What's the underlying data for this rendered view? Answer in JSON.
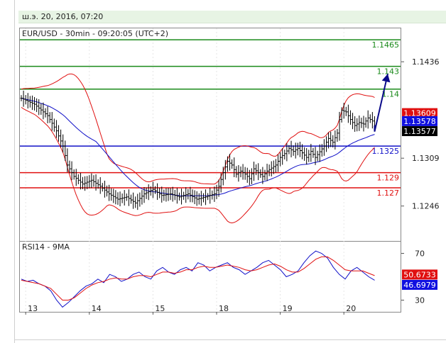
{
  "header": {
    "timestamp": "ш.э. 20, 2016, 07:20"
  },
  "chart_data": [
    {
      "type": "line",
      "panel": "price",
      "title": "EUR/USD - 30min - 09:20:05 (UTC+2)",
      "x_tick_labels": [
        "13",
        "14",
        "15",
        "18",
        "19",
        "20"
      ],
      "y_tick_labels": [
        "1.1436",
        "1.1309",
        "1.1246"
      ],
      "ylim": [
        1.12,
        1.148
      ],
      "levels": [
        {
          "label": "1.1465",
          "value": 1.1465,
          "color": "#1a8a1a"
        },
        {
          "label": "1.143",
          "value": 1.143,
          "color": "#1a8a1a"
        },
        {
          "label": "1.14",
          "value": 1.14,
          "color": "#1a8a1a"
        },
        {
          "label": "1.1325",
          "value": 1.1325,
          "color": "#1010c8"
        },
        {
          "label": "1.129",
          "value": 1.129,
          "color": "#e01010"
        },
        {
          "label": "1.127",
          "value": 1.127,
          "color": "#e01010"
        }
      ],
      "badges": [
        {
          "label": "1.13609",
          "value": 1.13609,
          "color": "#e01010"
        },
        {
          "label": "1.13578",
          "value": 1.13578,
          "color": "#1010e0"
        },
        {
          "label": "1.13577",
          "value": 1.13577,
          "color": "#000000"
        }
      ],
      "price_path": [
        [
          0,
          1.1388
        ],
        [
          6,
          1.138
        ],
        [
          12,
          1.1365
        ],
        [
          16,
          1.1345
        ],
        [
          19,
          1.1325
        ],
        [
          21,
          1.13
        ],
        [
          24,
          1.1285
        ],
        [
          28,
          1.1275
        ],
        [
          32,
          1.128
        ],
        [
          36,
          1.1272
        ],
        [
          40,
          1.1262
        ],
        [
          44,
          1.1255
        ],
        [
          48,
          1.1258
        ],
        [
          52,
          1.125
        ],
        [
          56,
          1.1262
        ],
        [
          60,
          1.1268
        ],
        [
          64,
          1.126
        ],
        [
          68,
          1.1262
        ],
        [
          72,
          1.1258
        ],
        [
          76,
          1.1262
        ],
        [
          80,
          1.1255
        ],
        [
          84,
          1.1258
        ],
        [
          88,
          1.1262
        ],
        [
          90,
          1.1272
        ],
        [
          92,
          1.129
        ],
        [
          94,
          1.1305
        ],
        [
          96,
          1.13
        ],
        [
          98,
          1.1288
        ],
        [
          100,
          1.1292
        ],
        [
          102,
          1.1288
        ],
        [
          104,
          1.1282
        ],
        [
          106,
          1.1295
        ],
        [
          108,
          1.129
        ],
        [
          110,
          1.1285
        ],
        [
          112,
          1.1292
        ],
        [
          116,
          1.13
        ],
        [
          118,
          1.131
        ],
        [
          120,
          1.1315
        ],
        [
          122,
          1.1322
        ],
        [
          124,
          1.1318
        ],
        [
          126,
          1.1322
        ],
        [
          128,
          1.1316
        ],
        [
          130,
          1.131
        ],
        [
          132,
          1.1318
        ],
        [
          134,
          1.131
        ],
        [
          138,
          1.1325
        ],
        [
          140,
          1.1335
        ],
        [
          142,
          1.133
        ],
        [
          144,
          1.1342
        ],
        [
          145,
          1.136
        ],
        [
          146,
          1.1372
        ],
        [
          148,
          1.137
        ],
        [
          150,
          1.136
        ],
        [
          152,
          1.1352
        ],
        [
          154,
          1.1356
        ],
        [
          156,
          1.1354
        ],
        [
          158,
          1.1362
        ],
        [
          160,
          1.1358
        ],
        [
          161,
          1.1352
        ]
      ],
      "projection": [
        [
          161,
          1.1344
        ],
        [
          167,
          1.142
        ]
      ]
    },
    {
      "type": "line",
      "panel": "indicator",
      "title": "RSI14 - 9MA",
      "y_tick_labels": [
        "70",
        "30"
      ],
      "ylim": [
        20,
        80
      ],
      "badges": [
        {
          "label": "50.6733",
          "value": 50.6733,
          "color": "#e01010"
        },
        {
          "label": "46.6979",
          "value": 46.6979,
          "color": "#1010e0"
        }
      ],
      "series": [
        {
          "color": "#1010c8",
          "values": [
            48,
            46,
            47,
            44,
            42,
            38,
            30,
            24,
            28,
            33,
            38,
            42,
            44,
            48,
            45,
            52,
            50,
            46,
            48,
            52,
            54,
            50,
            48,
            55,
            58,
            54,
            52,
            56,
            58,
            55,
            62,
            60,
            55,
            58,
            60,
            62,
            58,
            56,
            52,
            55,
            58,
            62,
            64,
            60,
            56,
            50,
            52,
            55,
            62,
            68,
            72,
            70,
            66,
            58,
            52,
            48,
            55,
            58,
            54,
            50,
            47
          ]
        },
        {
          "color": "#e01010",
          "values": [
            47,
            46,
            45,
            44,
            42,
            40,
            35,
            30,
            30,
            32,
            36,
            40,
            43,
            45,
            46,
            48,
            49,
            48,
            48,
            50,
            51,
            51,
            50,
            52,
            54,
            54,
            53,
            54,
            56,
            56,
            58,
            59,
            58,
            58,
            59,
            60,
            59,
            58,
            56,
            55,
            56,
            58,
            60,
            61,
            59,
            56,
            54,
            54,
            57,
            61,
            65,
            67,
            67,
            64,
            60,
            56,
            55,
            55,
            55,
            53,
            51
          ]
        }
      ]
    }
  ]
}
